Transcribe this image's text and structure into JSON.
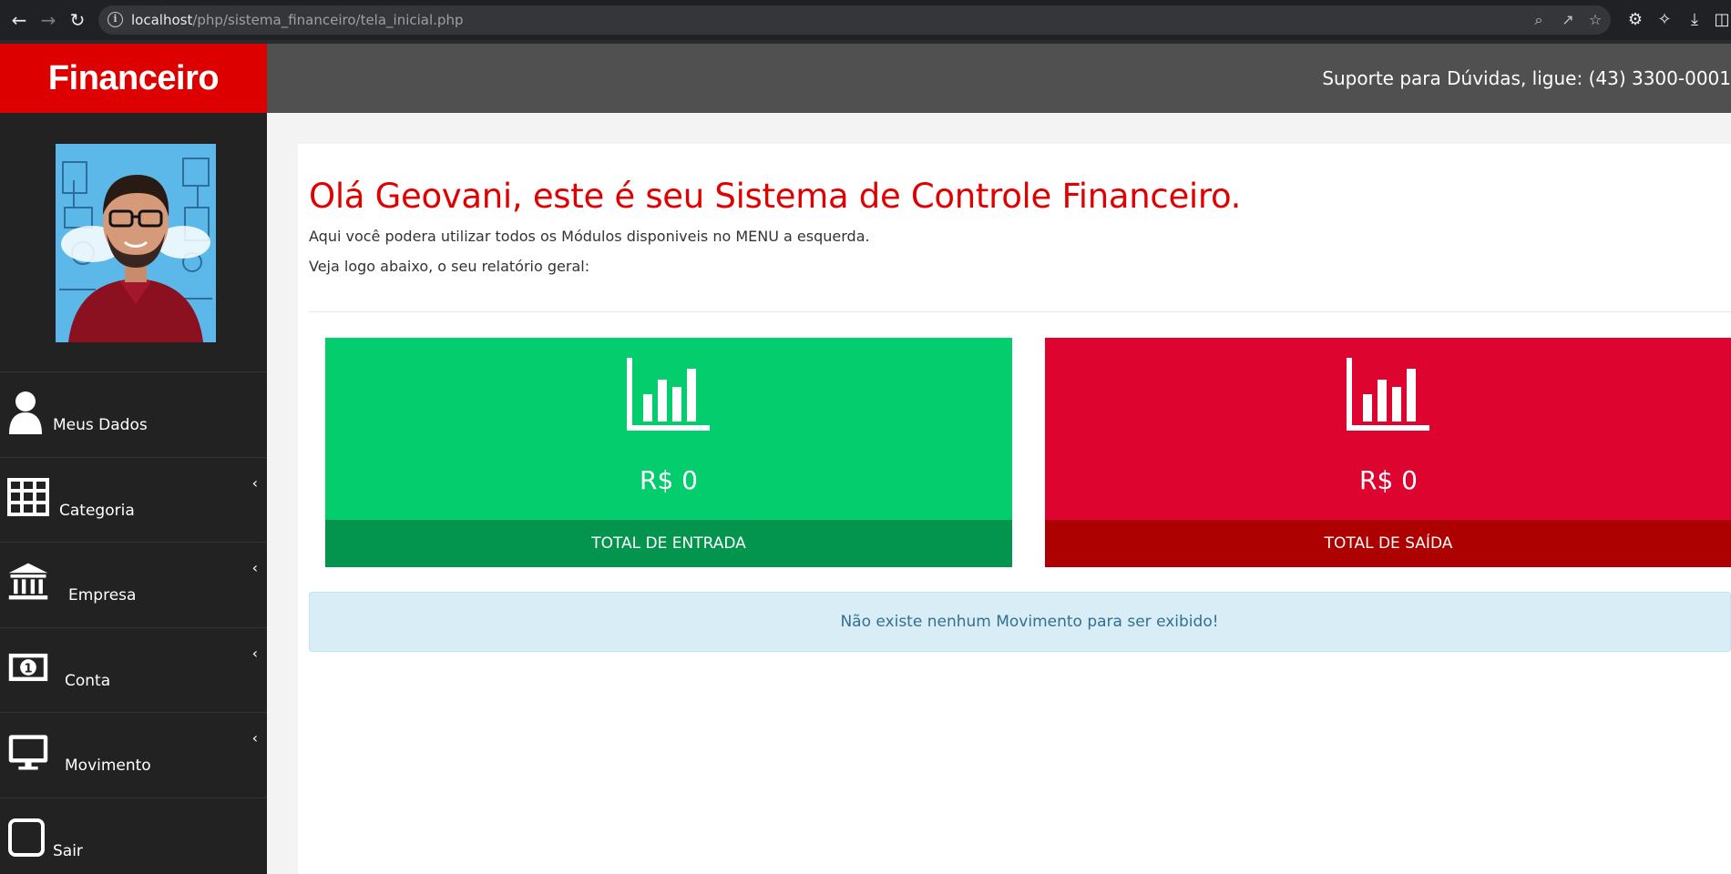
{
  "browser": {
    "back_icon": "arrow-left-icon",
    "forward_icon": "arrow-right-icon",
    "reload_icon": "reload-icon",
    "url_host": "localhost",
    "url_path": "/php/sistema_financeiro/tela_inicial.php"
  },
  "header": {
    "brand": "Financeiro",
    "support": "Suporte para Dúvidas, ligue: (43) 3300-0001",
    "brand_color": "#dd0000",
    "bar_color": "#505050"
  },
  "sidebar": {
    "items": [
      {
        "label": "Meus Dados",
        "icon": "user-icon",
        "has_arrow": false
      },
      {
        "label": "Categoria",
        "icon": "grid-icon",
        "has_arrow": true
      },
      {
        "label": "Empresa",
        "icon": "bank-icon",
        "has_arrow": true
      },
      {
        "label": "Conta",
        "icon": "money-icon",
        "has_arrow": true
      },
      {
        "label": "Movimento",
        "icon": "monitor-icon",
        "has_arrow": true
      },
      {
        "label": "Sair",
        "icon": "logout-icon",
        "has_arrow": false
      }
    ]
  },
  "main": {
    "greeting": "Olá Geovani, este é seu Sistema de Controle Financeiro.",
    "intro": "Aqui você podera utilizar todos os Módulos disponiveis no MENU a esquerda.",
    "report_hint": "Veja logo abaixo, o seu relatório geral:",
    "cards": [
      {
        "amount": "R$ 0",
        "label": "TOTAL DE ENTRADA",
        "color": "#04cd6e"
      },
      {
        "amount": "R$ 0",
        "label": "TOTAL DE SAÍDA",
        "color": "#dd0530"
      }
    ],
    "empty_message": "Não existe nenhum Movimento para ser exibido!"
  }
}
